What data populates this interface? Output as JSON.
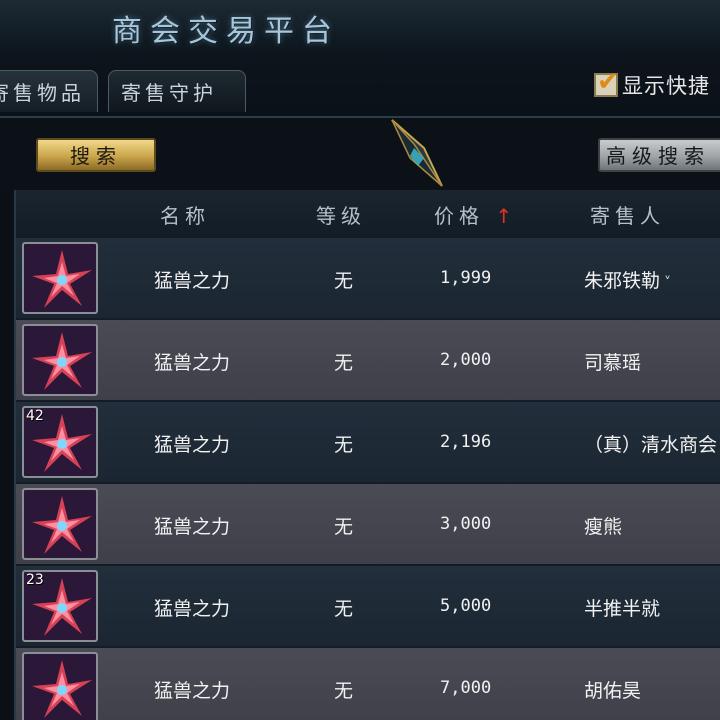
{
  "window": {
    "title": "商会交易平台"
  },
  "tabs": [
    {
      "label": "寄售物品"
    },
    {
      "label": "寄售守护"
    }
  ],
  "quick_toggle": {
    "label": "显示快捷",
    "checked": true
  },
  "toolbar": {
    "search_label": "搜索",
    "advanced_label": "高级搜索"
  },
  "table": {
    "headers": {
      "name": "名称",
      "level": "等级",
      "price": "价格",
      "seller": "寄售人"
    },
    "sort_indicator": "↑",
    "rows": [
      {
        "name": "猛兽之力",
        "level": "无",
        "price": "1,999",
        "seller": "朱邪铁勒",
        "stack": "",
        "icon": "beast-power-icon"
      },
      {
        "name": "猛兽之力",
        "level": "无",
        "price": "2,000",
        "seller": "司慕瑶",
        "stack": "",
        "icon": "beast-power-icon"
      },
      {
        "name": "猛兽之力",
        "level": "无",
        "price": "2,196",
        "seller": "（真）清水商会",
        "stack": "42",
        "icon": "beast-power-icon"
      },
      {
        "name": "猛兽之力",
        "level": "无",
        "price": "3,000",
        "seller": "瘦熊",
        "stack": "",
        "icon": "beast-power-icon"
      },
      {
        "name": "猛兽之力",
        "level": "无",
        "price": "5,000",
        "seller": "半推半就",
        "stack": "23",
        "icon": "beast-power-icon"
      },
      {
        "name": "猛兽之力",
        "level": "无",
        "price": "7,000",
        "seller": "胡佑昊",
        "stack": "",
        "icon": "beast-power-icon"
      }
    ]
  },
  "colors": {
    "accent_gold": "#c9a54c",
    "sort_arrow": "#e0341b",
    "title_glow": "#a8c6da"
  }
}
